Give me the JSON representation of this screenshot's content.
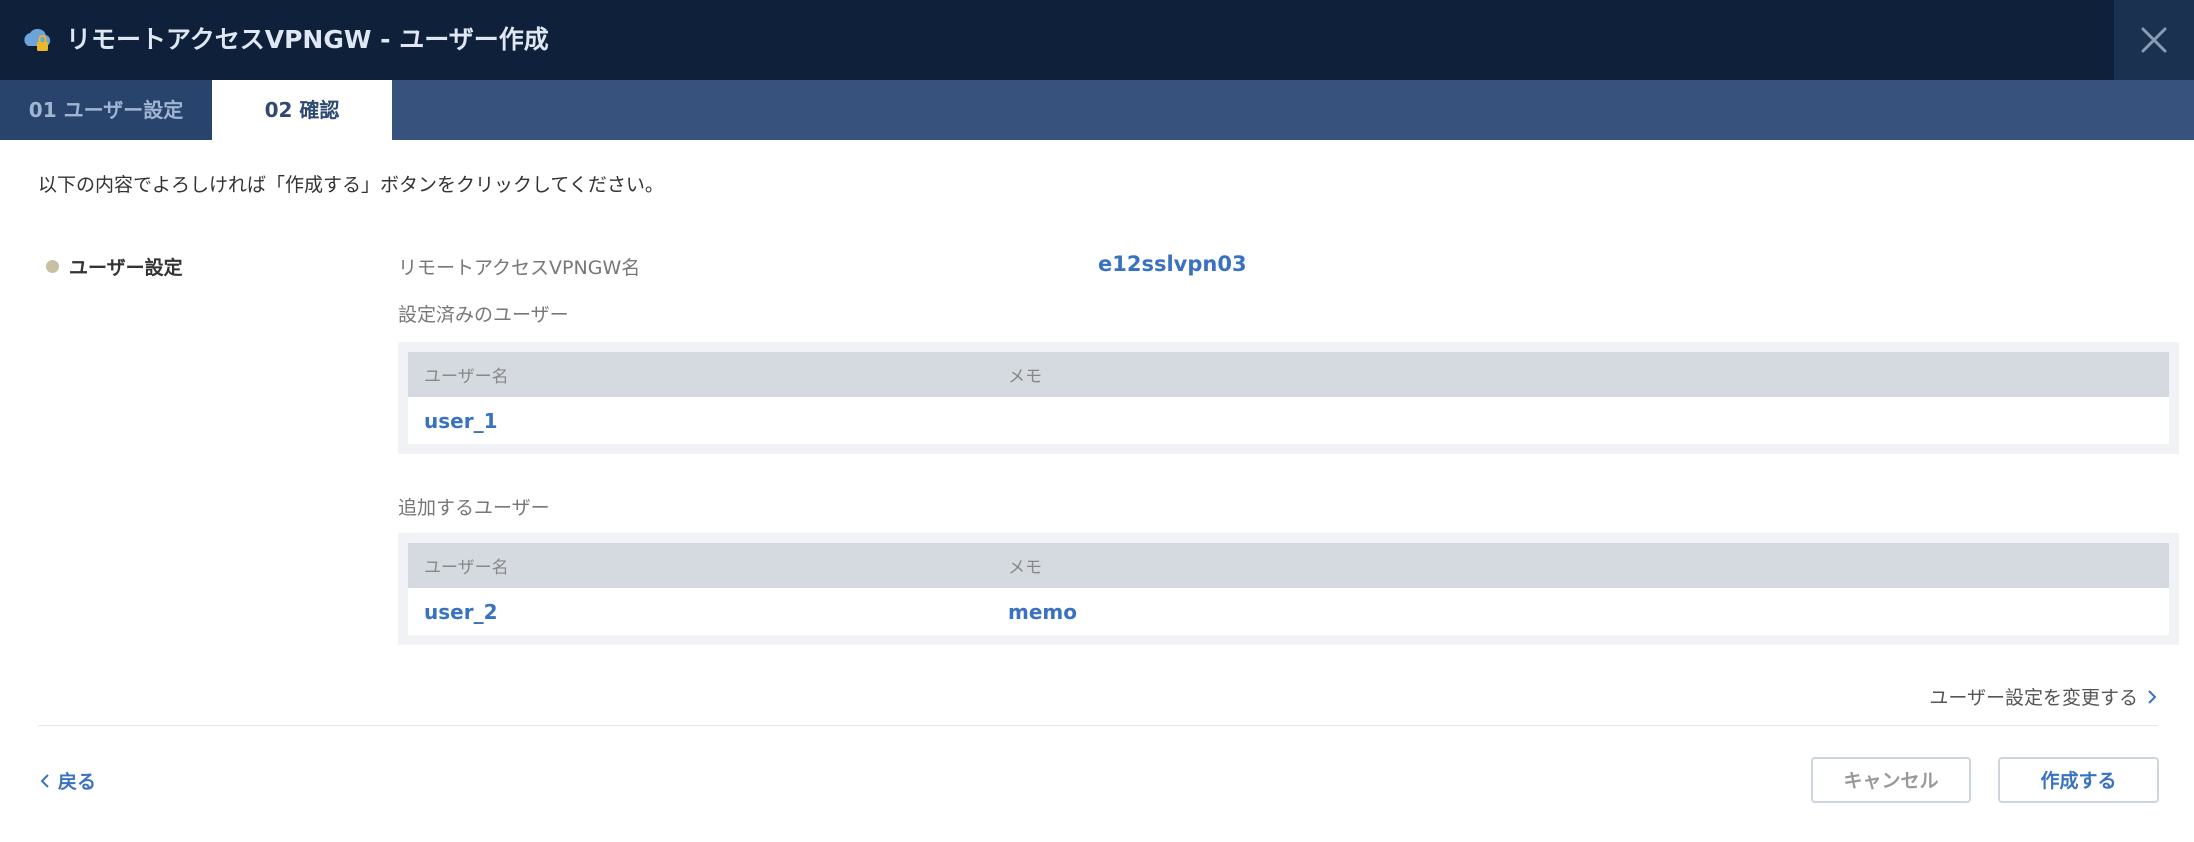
{
  "window": {
    "title": "リモートアクセスVPNGW - ユーザー作成",
    "app_icon": "cloud-lock-icon",
    "close_icon": "close-icon"
  },
  "tabs": [
    {
      "label": "01 ユーザー設定",
      "active": false
    },
    {
      "label": "02 確認",
      "active": true
    }
  ],
  "instruction": "以下の内容でよろしければ「作成する」ボタンをクリックしてください。",
  "section": {
    "title": "ユーザー設定",
    "vpngw_label": "リモートアクセスVPNGW名",
    "vpngw_value": "e12sslvpn03",
    "existing_users": {
      "label": "設定済みのユーザー",
      "headers": [
        "ユーザー名",
        "メモ"
      ],
      "rows": [
        {
          "username": "user_1",
          "memo": ""
        }
      ]
    },
    "new_users": {
      "label": "追加するユーザー",
      "headers": [
        "ユーザー名",
        "メモ"
      ],
      "rows": [
        {
          "username": "user_2",
          "memo": "memo"
        }
      ]
    },
    "change_link": "ユーザー設定を変更する"
  },
  "footer": {
    "back_label": "戻る",
    "cancel_label": "キャンセル",
    "create_label": "作成する"
  },
  "colors": {
    "header_bg": "#0f213a",
    "tabbar_bg": "#36527d",
    "accent_blue": "#3a72c2"
  }
}
